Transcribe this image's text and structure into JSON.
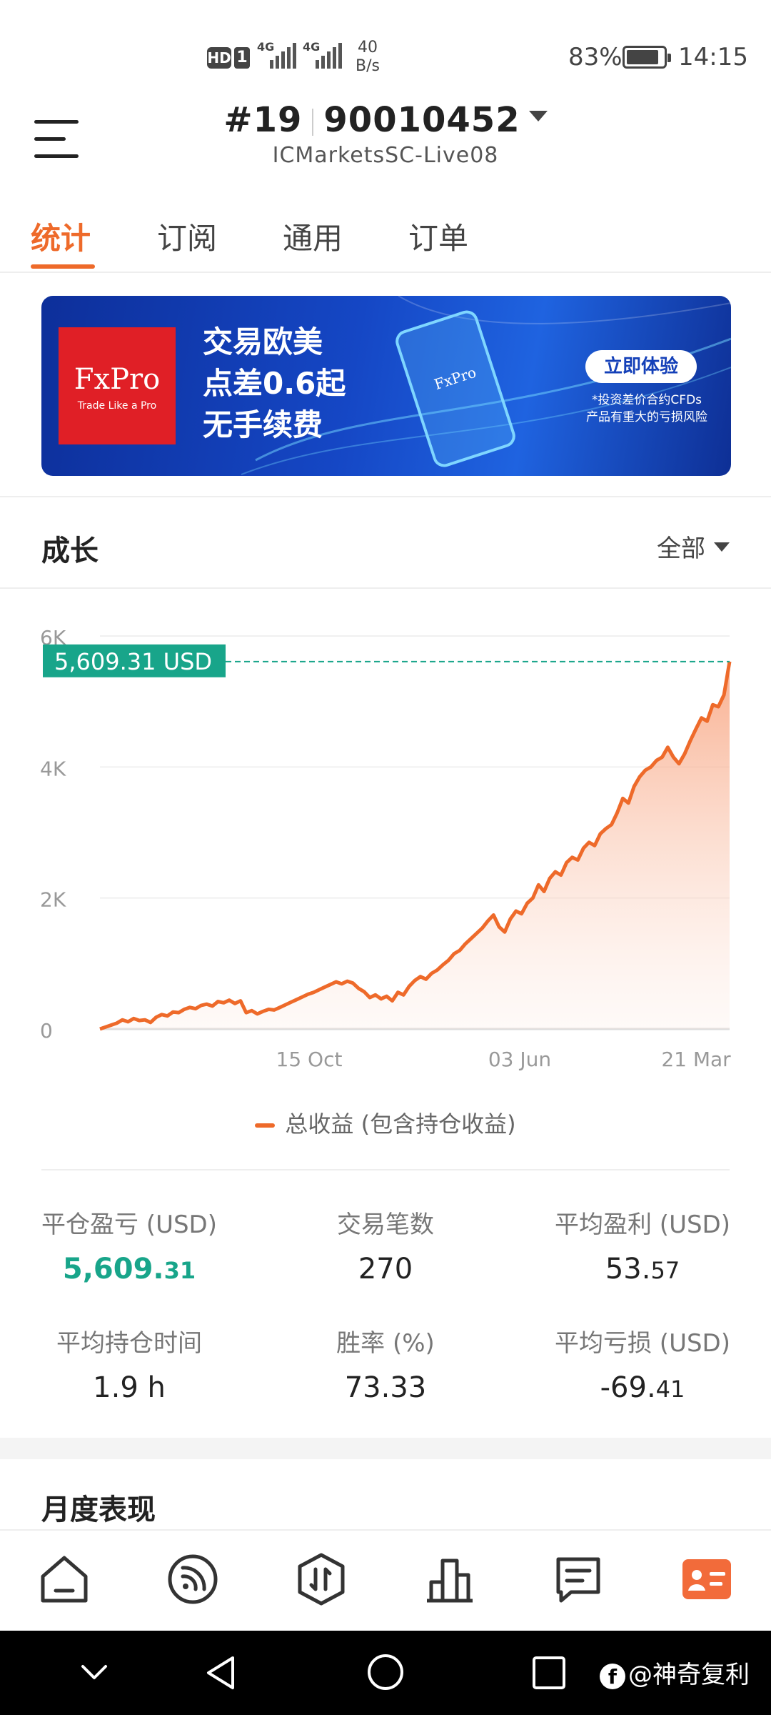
{
  "status_bar": {
    "hd": "HD",
    "sim": "1",
    "sig1": "4G",
    "sig2": "4G",
    "net_speed": "40",
    "net_unit": "B/s",
    "battery": "83%",
    "time": "14:15"
  },
  "header": {
    "account_rank": "#19",
    "account_number": "90010452",
    "server": "ICMarketsSC-Live08"
  },
  "tabs": [
    {
      "label": "统计",
      "active": true
    },
    {
      "label": "订阅",
      "active": false
    },
    {
      "label": "通用",
      "active": false
    },
    {
      "label": "订单",
      "active": false
    }
  ],
  "banner": {
    "brand": "FxPro",
    "brand_tagline": "Trade Like a Pro",
    "line1": "交易欧美",
    "line2": "点差0.6起",
    "line3": "无手续费",
    "cta": "立即体验",
    "note1": "*投资差价合约CFDs",
    "note2": "产品有重大的亏损风险"
  },
  "growth": {
    "title": "成长",
    "range": "全部"
  },
  "chart_data": {
    "type": "area",
    "y_ticks": [
      "0",
      "2K",
      "4K",
      "6K"
    ],
    "x_ticks": [
      "15 Oct",
      "03 Jun",
      "21 Mar"
    ],
    "ylim": [
      0,
      6000
    ],
    "current_label": "5,609.31 USD",
    "current_value": 5609.31,
    "series": [
      {
        "name": "总收益 (包含持仓收益)",
        "color": "#ee6a2a",
        "values": [
          0,
          30,
          60,
          90,
          140,
          110,
          160,
          130,
          140,
          100,
          180,
          220,
          200,
          260,
          250,
          300,
          330,
          310,
          360,
          380,
          350,
          420,
          400,
          440,
          390,
          430,
          250,
          280,
          230,
          270,
          300,
          290,
          330,
          370,
          410,
          450,
          490,
          530,
          560,
          600,
          640,
          680,
          720,
          690,
          730,
          700,
          620,
          570,
          480,
          520,
          460,
          500,
          430,
          560,
          520,
          650,
          740,
          800,
          760,
          850,
          900,
          980,
          1050,
          1150,
          1200,
          1300,
          1380,
          1460,
          1540,
          1650,
          1740,
          1560,
          1480,
          1680,
          1800,
          1760,
          1920,
          2000,
          2200,
          2100,
          2300,
          2400,
          2350,
          2540,
          2620,
          2580,
          2760,
          2850,
          2800,
          2980,
          3060,
          3120,
          3300,
          3520,
          3450,
          3700,
          3850,
          3950,
          4000,
          4100,
          4150,
          4300,
          4150,
          4050,
          4200,
          4400,
          4580,
          4750,
          4700,
          4950,
          4920,
          5100,
          5609.31
        ]
      }
    ]
  },
  "legend": {
    "label": "总收益 (包含持仓收益)"
  },
  "stats": {
    "closed_pnl_label": "平仓盈亏 (USD)",
    "closed_pnl_int": "5,609.",
    "closed_pnl_dec": "31",
    "trades_label": "交易笔数",
    "trades_value": "270",
    "avg_profit_label": "平均盈利 (USD)",
    "avg_profit_int": "53.",
    "avg_profit_dec": "57",
    "avg_hold_label": "平均持仓时间",
    "avg_hold_value": "1.9 h",
    "win_rate_label": "胜率 (%)",
    "win_rate_value": "73.33",
    "avg_loss_label": "平均亏损 (USD)",
    "avg_loss_int": "-69.",
    "avg_loss_dec": "41"
  },
  "monthly": {
    "title": "月度表现"
  },
  "bottom_nav": [
    {
      "icon": "home-icon"
    },
    {
      "icon": "signal-feed-icon"
    },
    {
      "icon": "trade-icon"
    },
    {
      "icon": "chart-bars-icon"
    },
    {
      "icon": "message-icon"
    },
    {
      "icon": "profile-card-icon",
      "active": true
    }
  ],
  "watermark": {
    "logo": "f",
    "text": "@神奇复利"
  },
  "colors": {
    "accent": "#ee6a2a",
    "green": "#18a58a",
    "banner_blue": "#1547c5"
  }
}
